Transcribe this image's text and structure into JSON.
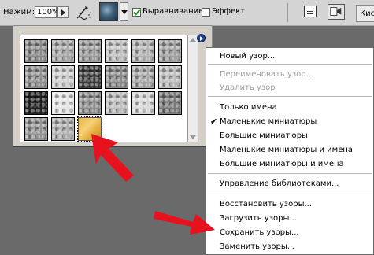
{
  "options_bar": {
    "pressure_label": "Нажим:",
    "pressure_value": "100%",
    "aligned_label": "Выравнивание",
    "aligned_checked": true,
    "impressionist_label": "Эффект",
    "impressionist_checked": false,
    "workspace_tab_label": "Кис"
  },
  "pattern_picker": {
    "swatch_rows": [
      [
        "#8b8b8b",
        "#a9a9a9",
        "#9a9a9a",
        "#c2c2c2",
        "#b5b5b5",
        "#a2a2a2"
      ],
      [
        "#909090",
        "#cfcfcf",
        "#3a3a3a",
        "#8a8a8a",
        "#aaaaaa",
        "#bdbdbd"
      ],
      [
        "#1e1e1e",
        "#e6e6e6",
        "#8c8c8c",
        "#bfbfbf",
        "#d8d8d8",
        "#7a7a7a"
      ],
      [
        "#959595",
        "#b0b0b0",
        "#e8b448"
      ]
    ],
    "selected_swatch_color": "#e8b448"
  },
  "context_menu": {
    "items": [
      {
        "label": "Новый узор...",
        "disabled": false
      },
      {
        "label": "Переименовать узор...",
        "disabled": true
      },
      {
        "label": "Удалить узор",
        "disabled": true
      },
      {
        "label": "Только имена",
        "disabled": false
      },
      {
        "label": "Маленькие миниатюры",
        "disabled": false,
        "checked": true
      },
      {
        "label": "Большие миниатюры",
        "disabled": false
      },
      {
        "label": "Маленькие миниатюры и имена",
        "disabled": false
      },
      {
        "label": "Большие миниатюры и имена",
        "disabled": false
      },
      {
        "label": "Управление библиотеками...",
        "disabled": false
      },
      {
        "label": "Восстановить узоры...",
        "disabled": false
      },
      {
        "label": "Загрузить узоры...",
        "disabled": false
      },
      {
        "label": "Сохранить узоры...",
        "disabled": false
      },
      {
        "label": "Заменить узоры...",
        "disabled": false
      }
    ]
  },
  "colors": {
    "canvas_bg": "#6a6a6a",
    "options_bar_bg": "#d4d4d4",
    "annotation_arrow": "#e8121e"
  },
  "icons": [
    "airbrush-icon",
    "pattern-swatch-icon",
    "palette-icon",
    "bridge-icon",
    "panel-menu-icon",
    "checkmark-icon"
  ]
}
